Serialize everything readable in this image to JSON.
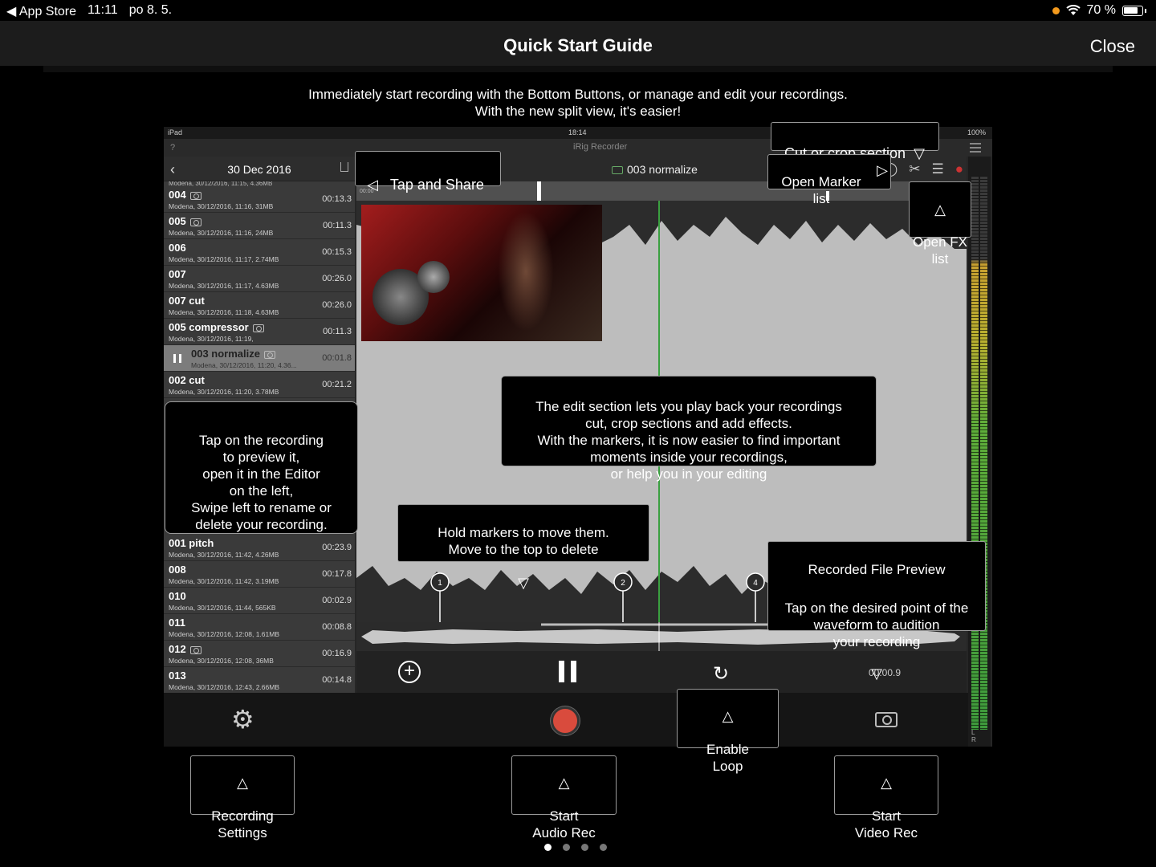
{
  "status_bar": {
    "back_app": "◀ App Store",
    "time": "11:11",
    "date": "po 8. 5.",
    "battery": "70 %"
  },
  "header": {
    "title": "Quick Start Guide",
    "close": "Close"
  },
  "intro": {
    "line1": "Immediately start recording with the Bottom Buttons, or manage and edit  your  recordings.",
    "line2": "With the new split view, it's easier!"
  },
  "inner": {
    "ipad_left": "iPad",
    "ipad_time": "18:14",
    "ipad_battery": "100%",
    "help": "?",
    "app_name": "iRig Recorder",
    "list_date": "30 Dec 2016",
    "partial_meta": "Modena, 30/12/2016, 11:15, 4.36MB",
    "recordings": [
      {
        "name": "004",
        "meta": "Modena, 30/12/2016, 11:16, 31MB",
        "time": "00:13.3"
      },
      {
        "name": "005",
        "meta": "Modena, 30/12/2016, 11:16, 24MB",
        "time": "00:11.3"
      },
      {
        "name": "006",
        "meta": "Modena, 30/12/2016, 11:17, 2.74MB",
        "time": "00:15.3"
      },
      {
        "name": "007",
        "meta": "Modena, 30/12/2016, 11:17, 4.63MB",
        "time": "00:26.0"
      },
      {
        "name": "007 cut",
        "meta": "Modena, 30/12/2016, 11:18, 4.63MB",
        "time": "00:26.0"
      },
      {
        "name": "005 compressor",
        "meta": "Modena, 30/12/2016, 11:19,",
        "time": "00:11.3"
      },
      {
        "name": "003 normalize",
        "meta": "Modena, 30/12/2016, 11:20, 4.36...",
        "time": "00:01.8"
      },
      {
        "name": "002 cut",
        "meta": "Modena, 30/12/2016, 11:20, 3.78MB",
        "time": "00:21.2"
      }
    ],
    "recordings_lower": [
      {
        "name": "001 pitch",
        "meta": "Modena, 30/12/2016, 11:42, 4.26MB",
        "time": "00:23.9"
      },
      {
        "name": "008",
        "meta": "Modena, 30/12/2016, 11:42, 3.19MB",
        "time": "00:17.8"
      },
      {
        "name": "010",
        "meta": "Modena, 30/12/2016, 11:44, 565KB",
        "time": "00:02.9"
      },
      {
        "name": "011",
        "meta": "Modena, 30/12/2016, 12:08, 1.61MB",
        "time": "00:08.8"
      },
      {
        "name": "012",
        "meta": "Modena, 30/12/2016, 12:08, 36MB",
        "time": "00:16.9"
      },
      {
        "name": "013",
        "meta": "Modena, 30/12/2016, 12:43, 2.66MB",
        "time": "00:14.8"
      }
    ],
    "editor_file": "003 normalize",
    "ruler_start": "00:00",
    "markers": [
      "1",
      "2",
      "4"
    ],
    "transport_time": "00:00.9",
    "meter_lr": "L R"
  },
  "callouts": {
    "tap_share": "Tap and Share",
    "cut_crop": "Cut or crop section",
    "marker_list": "Open Marker\nlist",
    "fx_list": "Open FX\nlist",
    "tap_recording": "Tap on the recording\nto preview it,\nopen it in the Editor\non the left,\nSwipe left to rename or\ndelete your recording.",
    "edit_section": "The edit section lets you play back your recordings\ncut, crop sections and add effects.\nWith the markers, it is now easier to find important\nmoments inside your recordings,\nor help you in your editing",
    "hold_markers": "Hold markers to move them.\nMove to the top to delete",
    "preview_title": "Recorded File Preview",
    "preview_body": "Tap on the desired point of the\nwaveform to audition\nyour recording",
    "enable_loop": "Enable\nLoop",
    "rec_settings": "Recording\nSettings",
    "audio_rec": "Start\nAudio Rec",
    "video_rec": "Start\nVideo Rec"
  },
  "page_dots": {
    "count": 4,
    "active": 0
  }
}
